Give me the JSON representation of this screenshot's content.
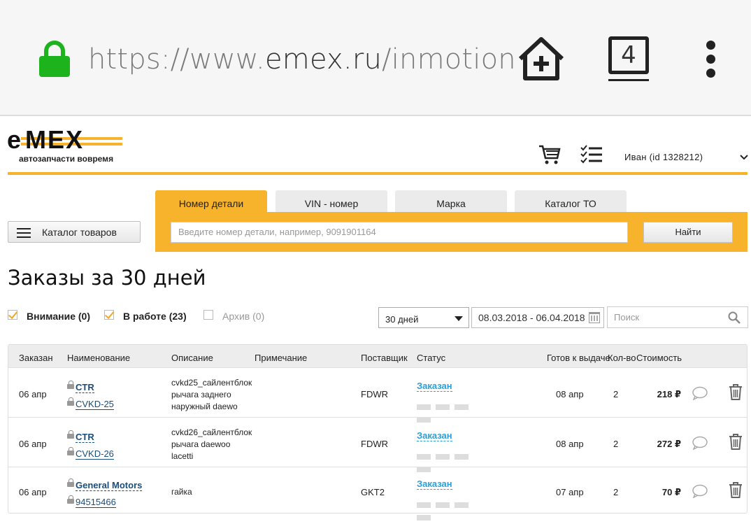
{
  "browser": {
    "url_scheme": "https://www.",
    "url_host": "emex.ru",
    "url_path": "/inmotion",
    "tab_count": "4"
  },
  "site": {
    "logo_text": "EMEX",
    "tagline": "автозапчасти вовремя",
    "user": "Иван  (id 1328212)"
  },
  "catalog_button": "Каталог товаров",
  "search": {
    "tabs": [
      "Номер детали",
      "VIN - номер",
      "Марка",
      "Каталог ТО"
    ],
    "placeholder": "Введите номер детали, например, 9091901164",
    "button": "Найти"
  },
  "page_title": "Заказы за 30 дней",
  "filters": [
    {
      "label": "Внимание (0)",
      "checked": true
    },
    {
      "label": "В работе (23)",
      "checked": true
    },
    {
      "label": "Архив (0)",
      "checked": false
    }
  ],
  "period": "30 дней",
  "date_range": "08.03.2018 - 06.04.2018",
  "find_placeholder": "Поиск",
  "table": {
    "headers": [
      "Заказан",
      "Наименование",
      "Описание",
      "Примечание",
      "Поставщик",
      "Статус",
      "Готов к выдаче",
      "Кол-во",
      "Стоимость"
    ],
    "rows": [
      {
        "ordered": "06 апр",
        "brand": "CTR",
        "part": "CVKD-25",
        "desc": [
          "cvkd25_сайлентблок",
          "рычага заднего",
          "наружный daewo"
        ],
        "supplier": "FDWR",
        "status": "Заказан",
        "ready": "08 апр",
        "qty": "2",
        "price": "218 ₽"
      },
      {
        "ordered": "06 апр",
        "brand": "CTR",
        "part": "CVKD-26",
        "desc": [
          "cvkd26_сайлентблок",
          "рычага daewoo",
          "lacetti"
        ],
        "supplier": "FDWR",
        "status": "Заказан",
        "ready": "08 апр",
        "qty": "2",
        "price": "272 ₽"
      },
      {
        "ordered": "06 апр",
        "brand": "General Motors",
        "part": "94515466",
        "desc": [
          "гайка"
        ],
        "supplier": "GKT2",
        "status": "Заказан",
        "ready": "07 апр",
        "qty": "2",
        "price": "70 ₽"
      }
    ]
  },
  "colors": {
    "accent": "#f7b32b",
    "link": "#1a4e7d",
    "status": "#2a9fd8",
    "lock": "#1db31d"
  }
}
